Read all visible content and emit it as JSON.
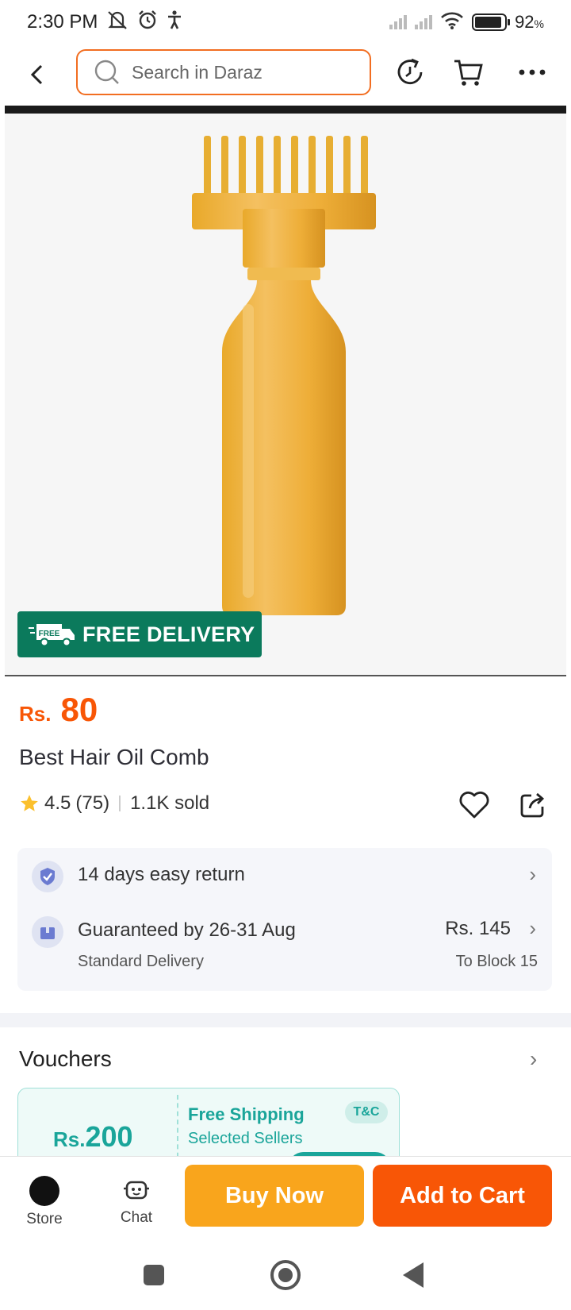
{
  "status_bar": {
    "time": "2:30 PM",
    "battery": "92",
    "battery_unit": "%",
    "battery_level": 0.92
  },
  "search": {
    "placeholder": "Search in Daraz"
  },
  "product": {
    "free_badge_icon_text": "FREE",
    "free_delivery": "FREE DELIVERY",
    "price_currency": "Rs.",
    "price": "80",
    "title": "Best Hair Oil Comb",
    "rating": "4.5",
    "reviews": "(75)",
    "sold": "1.1K sold"
  },
  "services": {
    "return_text": "14 days easy return",
    "delivery_text": "Guaranteed by 26-31 Aug",
    "delivery_type": "Standard Delivery",
    "delivery_price": "Rs. 145",
    "delivery_destination": "To Block 15"
  },
  "vouchers": {
    "title": "Vouchers",
    "items": [
      {
        "currency": "Rs.",
        "amount": "200",
        "type": "Free Shipping",
        "scope": "Selected Sellers",
        "tc": "T&C"
      }
    ]
  },
  "bottom_bar": {
    "store_label": "Store",
    "chat_label": "Chat",
    "buy_now": "Buy Now",
    "add_to_cart": "Add to Cart"
  },
  "colors": {
    "brand_orange": "#f85606",
    "buy_yellow": "#f9a51c",
    "free_green": "#0b7a5c",
    "voucher_teal": "#1aa59a"
  }
}
